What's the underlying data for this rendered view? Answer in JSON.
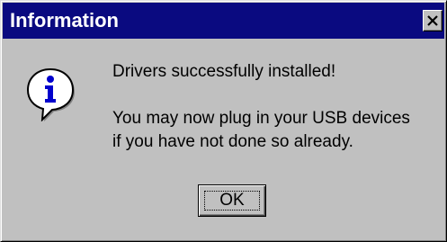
{
  "window": {
    "title": "Information",
    "titlebar_color": "#0a0a80",
    "face_color": "#c0c0c0",
    "close_icon": "close-icon"
  },
  "message": {
    "icon": "information-icon",
    "line1": "Drivers successfully installed!",
    "line2": "You may now plug in your USB devices",
    "line3": "if you have not done so already."
  },
  "buttons": {
    "ok_label": "OK"
  }
}
